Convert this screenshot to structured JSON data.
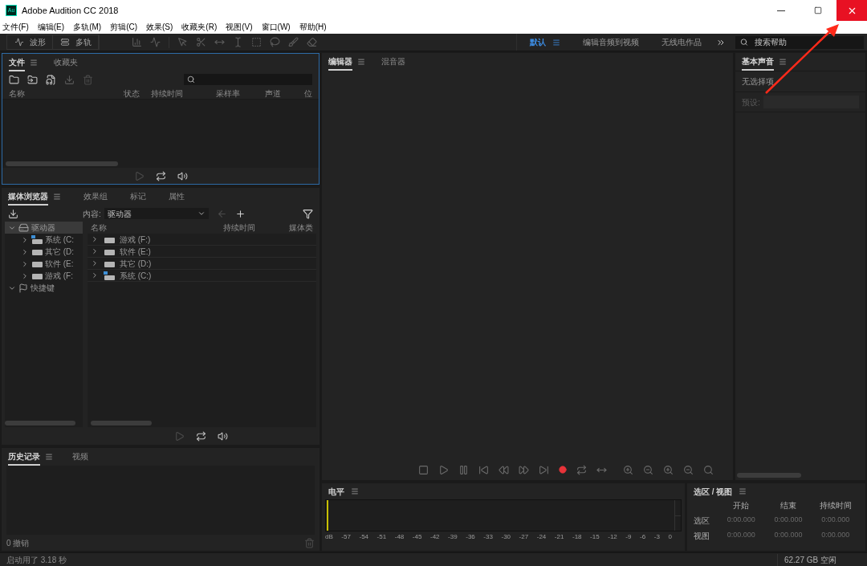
{
  "window": {
    "title": "Adobe Audition CC 2018",
    "app_icon": "Au"
  },
  "menu": [
    "文件(F)",
    "编辑(E)",
    "多轨(M)",
    "剪辑(C)",
    "效果(S)",
    "收藏夹(R)",
    "视图(V)",
    "窗口(W)",
    "帮助(H)"
  ],
  "modes": [
    {
      "label": "波形",
      "kind": "waveform",
      "selected": false
    },
    {
      "label": "多轨",
      "kind": "multitrack",
      "selected": false
    }
  ],
  "workspaces": [
    {
      "label": "默认",
      "selected": true
    },
    {
      "label": "编辑音频到视频",
      "selected": false
    },
    {
      "label": "无线电作品",
      "selected": false
    }
  ],
  "help_search": {
    "placeholder": "搜索帮助"
  },
  "files_panel": {
    "tabs": [
      {
        "label": "文件",
        "selected": true
      },
      {
        "label": "收藏夹",
        "selected": false
      }
    ],
    "columns": [
      "名称",
      "状态",
      "持续时间",
      "采样率",
      "声道",
      "位"
    ]
  },
  "media_browser": {
    "tabs": [
      {
        "label": "媒体浏览器",
        "selected": true
      },
      {
        "label": "效果组",
        "selected": false
      },
      {
        "label": "标记",
        "selected": false
      },
      {
        "label": "属性",
        "selected": false
      }
    ],
    "content_label": "内容:",
    "content_value": "驱动器",
    "tree": [
      {
        "label": "驱动器",
        "kind": "drives",
        "expanded": true,
        "selected": true,
        "children": [
          {
            "label": "系统 (C:",
            "kind": "system",
            "expanded": false
          },
          {
            "label": "其它 (D:",
            "kind": "drive",
            "expanded": false
          },
          {
            "label": "软件 (E:",
            "kind": "drive",
            "expanded": false
          },
          {
            "label": "游戏 (F:",
            "kind": "drive",
            "expanded": false
          }
        ]
      },
      {
        "label": "快捷键",
        "kind": "shortcuts",
        "expanded": true,
        "selected": false
      }
    ],
    "columns": [
      "名称",
      "持续时间",
      "媒体类"
    ],
    "rows": [
      {
        "name": "游戏 (F:)",
        "kind": "drive"
      },
      {
        "name": "软件 (E:)",
        "kind": "drive"
      },
      {
        "name": "其它 (D:)",
        "kind": "drive"
      },
      {
        "name": "系统 (C:)",
        "kind": "system"
      }
    ]
  },
  "history": {
    "tabs": [
      {
        "label": "历史记录",
        "selected": true
      },
      {
        "label": "视频",
        "selected": false
      }
    ],
    "undo_count": "0 撤销"
  },
  "editor": {
    "tabs": [
      {
        "label": "编辑器",
        "selected": true
      },
      {
        "label": "混音器",
        "selected": false
      }
    ]
  },
  "essential_sound": {
    "tabs": [
      {
        "label": "基本声音",
        "selected": true
      }
    ],
    "message": "无选择项",
    "preset_label": "预设:"
  },
  "levels": {
    "title": "电平",
    "scale": [
      "dB",
      "-57",
      "-54",
      "-51",
      "-48",
      "-45",
      "-42",
      "-39",
      "-36",
      "-33",
      "-30",
      "-27",
      "-24",
      "-21",
      "-18",
      "-15",
      "-12",
      "-9",
      "-6",
      "-3",
      "0"
    ]
  },
  "selection_view": {
    "title": "选区 / 视图",
    "columns": [
      "开始",
      "结束",
      "持续时间"
    ],
    "rows": [
      {
        "label": "选区",
        "values": [
          "0:00.000",
          "0:00.000",
          "0:00.000"
        ]
      },
      {
        "label": "视图",
        "values": [
          "0:00.000",
          "0:00.000",
          "0:00.000"
        ]
      }
    ]
  },
  "status_bar": {
    "message": "启动用了 3.18 秒",
    "free_space": "62.27 GB 空闲"
  }
}
